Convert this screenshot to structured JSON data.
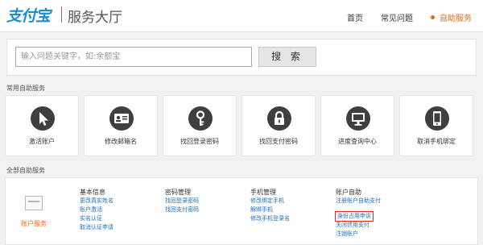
{
  "header": {
    "logo": "支付宝",
    "title": "服务大厅",
    "nav": [
      {
        "label": "首页",
        "active": false
      },
      {
        "label": "常见问题",
        "active": false
      },
      {
        "label": "自助服务",
        "active": true
      }
    ]
  },
  "search": {
    "placeholder": "输入问题关键字，如:余额宝",
    "button": "搜 索"
  },
  "common": {
    "title": "常用自助服务",
    "items": [
      {
        "label": "激活账户",
        "icon": "cursor-icon"
      },
      {
        "label": "修改邮箱名",
        "icon": "id-card-icon"
      },
      {
        "label": "找回登录密码",
        "icon": "key-icon"
      },
      {
        "label": "找回支付密码",
        "icon": "lock-icon"
      },
      {
        "label": "进度查询中心",
        "icon": "monitor-icon"
      },
      {
        "label": "取消手机绑定",
        "icon": "phone-icon"
      }
    ]
  },
  "all": {
    "title": "全部自助服务",
    "account_label": "账户服务",
    "columns": [
      {
        "head": "基本信息",
        "links": [
          "更改真实姓名",
          "账户激活",
          "实名认证",
          "取消认证申请"
        ]
      },
      {
        "head": "密码管理",
        "links": [
          "找回登录密码",
          "找回支付密码"
        ]
      },
      {
        "head": "手机管理",
        "links": [
          "修改绑定手机",
          "解绑手机",
          "修改手机登录名"
        ]
      },
      {
        "head": "账户自助",
        "links": [
          "注册账户自助支付",
          "身份占用申诉",
          "关闭信用支付",
          "注销账户"
        ],
        "highlighted_index": 1
      }
    ]
  },
  "colors": {
    "brand": "#1a8ed1",
    "accent": "#e46b18",
    "link": "#1a6fc2",
    "highlight_box": "#e02828",
    "icon_circle": "#3f3f3f"
  }
}
